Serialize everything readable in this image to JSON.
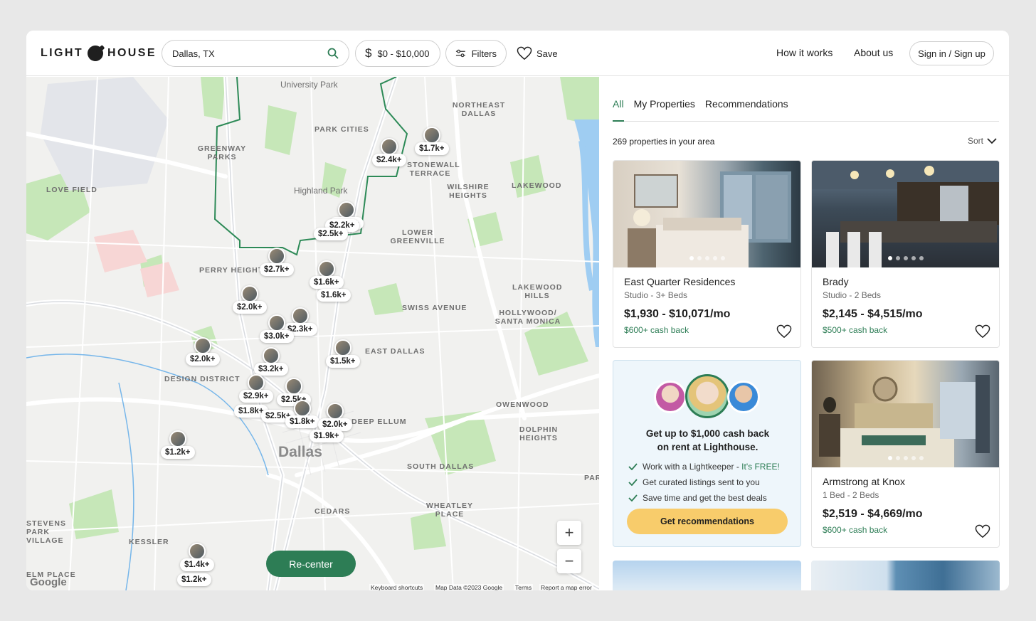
{
  "brand": {
    "logo_left": "LIGHT",
    "logo_right": "HOUSE",
    "accent": "#2d7d55"
  },
  "header": {
    "search_value": "Dallas, TX",
    "price_label": "$0 - $10,000",
    "filters_label": "Filters",
    "save_label": "Save",
    "how_label": "How it works",
    "about_label": "About us",
    "signin_label": "Sign in / Sign up"
  },
  "map": {
    "recenter_label": "Re-center",
    "zoom_in": "+",
    "zoom_out": "−",
    "google": "Google",
    "attribution": [
      "Keyboard shortcuts",
      "Map Data ©2023 Google",
      "Terms",
      "Report a map error"
    ],
    "labels": [
      "University Park",
      "NORTHEAST DALLAS",
      "PARK CITIES",
      "GREENWAY PARKS",
      "STONEWALL TERRACE",
      "LOVE FIELD",
      "Highland Park",
      "WILSHIRE HEIGHTS",
      "LAKEWOOD",
      "LOWER GREENVILLE",
      "PERRY HEIGHTS",
      "LAKEWOOD HILLS",
      "SWISS AVENUE",
      "HOLLYWOOD/ SANTA MONICA",
      "EAST DALLAS",
      "DESIGN DISTRICT",
      "OWENWOOD",
      "DOLPHIN HEIGHTS",
      "Dallas",
      "SOUTH DALLAS",
      "CEDARS",
      "WHEATLEY PLACE",
      "STEVENS PARK VILLAGE",
      "KESSLER",
      "ELM PLACE",
      "DEEP ELLUM",
      "PARK"
    ],
    "markers": [
      "$1.7k+",
      "$2.4k+",
      "$2.2k+",
      "$2.2k+",
      "$2.5k+",
      "$2.7k+",
      "$1.6k+",
      "$1.6k+",
      "$2.0k+",
      "$2.3k+",
      "$3.0k+",
      "$2.0k+",
      "$1.5k+",
      "$3.2k+",
      "$2.9k+",
      "$2.5k+",
      "$1.8k+",
      "$2.5k+",
      "$1.8k+",
      "$2.0k+",
      "$1.9k+",
      "$1.2k+",
      "$1.4k+",
      "$1.2k+"
    ]
  },
  "panel": {
    "tabs": [
      "All",
      "My Properties",
      "Recommendations"
    ],
    "count": "269 properties in your area",
    "sort": "Sort",
    "cards": [
      {
        "name": "East Quarter Residences",
        "beds": "Studio - 3+ Beds",
        "rent": "$1,930 - $10,071/mo",
        "cash": "$600+ cash back"
      },
      {
        "name": "Brady",
        "beds": "Studio - 2 Beds",
        "rent": "$2,145 - $4,515/mo",
        "cash": "$500+ cash back"
      },
      {
        "name": "Armstrong at Knox",
        "beds": "1 Bed - 2 Beds",
        "rent": "$2,519 - $4,669/mo",
        "cash": "$600+ cash back"
      }
    ],
    "promo": {
      "title_line1": "Get up to $1,000 cash back",
      "title_line2": "on rent at Lighthouse.",
      "item1": "Work with a Lightkeeper - ",
      "item1_free": "It's FREE!",
      "item2": "Get curated listings sent to you",
      "item3": "Save time and get the best deals",
      "cta": "Get recommendations"
    }
  }
}
